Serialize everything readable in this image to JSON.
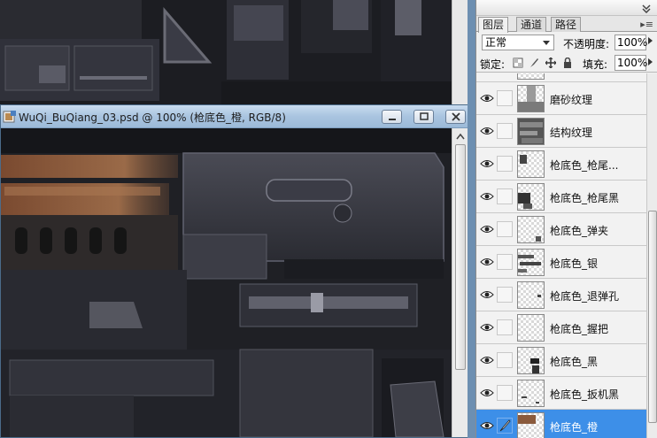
{
  "document": {
    "title": "WuQi_BuQiang_03.psd @ 100% (枪底色_橙, RGB/8)"
  },
  "layers_panel": {
    "tabs": [
      {
        "label": "图层",
        "active": true
      },
      {
        "label": "通道",
        "active": false
      },
      {
        "label": "路径",
        "active": false
      }
    ],
    "blend_mode": "正常",
    "opacity_label": "不透明度:",
    "opacity_value": "100%",
    "lock_label": "锁定:",
    "fill_label": "填充:",
    "fill_value": "100%",
    "layers": [
      {
        "name": "磨砂纹理",
        "visible": true,
        "selected": false
      },
      {
        "name": "结构纹理",
        "visible": true,
        "selected": false
      },
      {
        "name": "枪底色_枪尾...",
        "visible": true,
        "selected": false
      },
      {
        "name": "枪底色_枪尾黑",
        "visible": true,
        "selected": false
      },
      {
        "name": "枪底色_弹夹",
        "visible": true,
        "selected": false
      },
      {
        "name": "枪底色_银",
        "visible": true,
        "selected": false
      },
      {
        "name": "枪底色_退弹孔",
        "visible": true,
        "selected": false
      },
      {
        "name": "枪底色_握把",
        "visible": true,
        "selected": false
      },
      {
        "name": "枪底色_黑",
        "visible": true,
        "selected": false
      },
      {
        "name": "枪底色_扳机黑",
        "visible": true,
        "selected": false
      },
      {
        "name": "枪底色_橙",
        "visible": true,
        "selected": true
      }
    ]
  },
  "colors": {
    "selection": "#3d8fe8",
    "titlebar": "#a9c4e0",
    "texture_orange": "#8a5a3c"
  }
}
